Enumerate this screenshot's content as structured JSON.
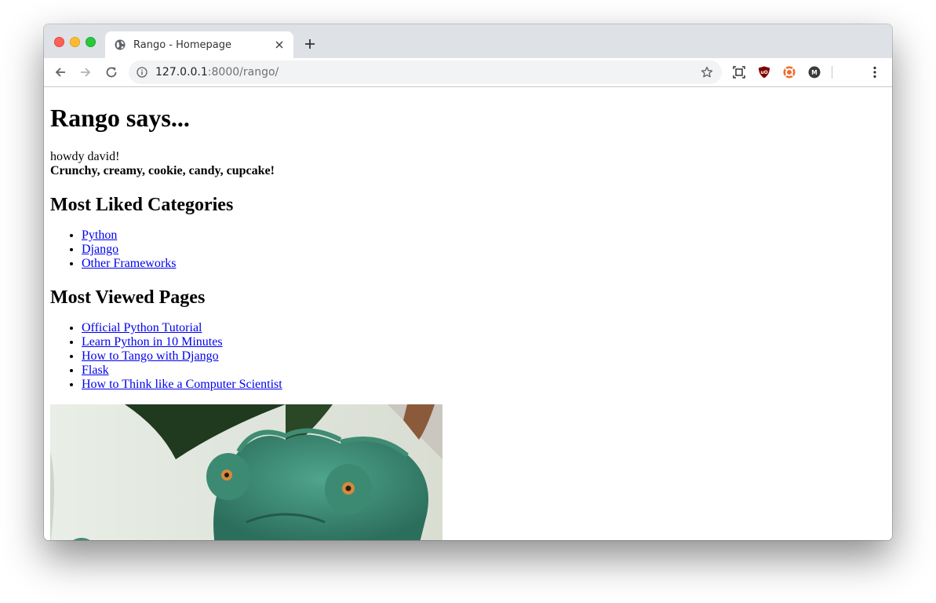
{
  "browser": {
    "tab_title": "Rango - Homepage",
    "url_host": "127.0.0.1",
    "url_rest": ":8000/rango/",
    "icons": {
      "back": "arrow-left-icon",
      "forward": "arrow-right-icon",
      "reload": "reload-icon",
      "info": "info-icon",
      "star": "star-icon",
      "screen": "screen-capture-icon",
      "ublock": "ublock-icon",
      "ext2": "lifebuoy-icon",
      "ext3": "m-extension-icon",
      "menu": "kebab-menu-icon"
    }
  },
  "page": {
    "title": "Rango says...",
    "greeting": "howdy david!",
    "tagline": "Crunchy, creamy, cookie, candy, cupcake!",
    "categories_heading": "Most Liked Categories",
    "categories": [
      "Python",
      "Django",
      "Other Frameworks"
    ],
    "pages_heading": "Most Viewed Pages",
    "pages": [
      "Official Python Tutorial",
      "Learn Python in 10 Minutes",
      "How to Tango with Django",
      "Flask",
      "How to Think like a Computer Scientist"
    ]
  },
  "colors": {
    "link": "#0000ee",
    "tabstrip": "#dee1e6",
    "omnibox": "#f1f3f4"
  }
}
